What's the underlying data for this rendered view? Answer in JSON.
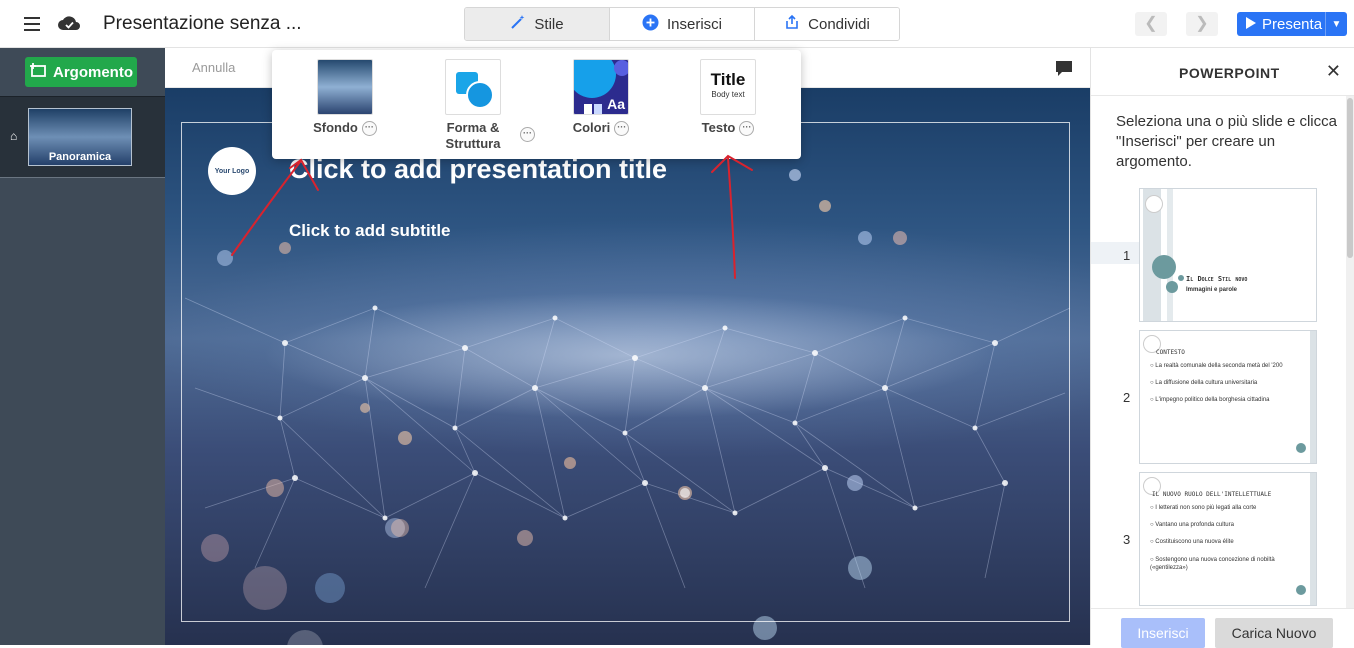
{
  "header": {
    "doc_title": "Presentazione senza ...",
    "tabs": [
      {
        "label": "Stile",
        "icon": "magic-wand-icon"
      },
      {
        "label": "Inserisci",
        "icon": "plus-circle-icon"
      },
      {
        "label": "Condividi",
        "icon": "share-icon"
      }
    ],
    "present_label": "Presenta"
  },
  "sidebar": {
    "topic_button": "Argomento",
    "thumb_label": "Panoramica"
  },
  "editor": {
    "undo_label": "Annulla",
    "logo_text": "Your Logo",
    "title_placeholder": "Click to add presentation title",
    "subtitle_placeholder": "Click to add subtitle"
  },
  "style_panel": {
    "items": [
      {
        "label": "Sfondo"
      },
      {
        "label": "Forma & Struttura"
      },
      {
        "label": "Colori",
        "badge": "Aa"
      },
      {
        "label": "Testo",
        "sample_title": "Title",
        "sample_body": "Body text"
      }
    ]
  },
  "right_panel": {
    "title": "POWERPOINT",
    "description": "Seleziona una o più slide e clicca \"Inserisci\" per creare un argomento.",
    "slides": [
      {
        "num": "1",
        "title": "Il Dolce Stil novo",
        "subtitle": "Immagini e parole",
        "bullets": []
      },
      {
        "num": "2",
        "title": "Contesto",
        "subtitle": "",
        "bullets": [
          "La realtà comunale della seconda metà del '200",
          "La diffusione della cultura universitaria",
          "L'impegno politico della borghesia cittadina"
        ]
      },
      {
        "num": "3",
        "title": "Il nuovo ruolo dell'intellettuale",
        "subtitle": "",
        "bullets": [
          "I letterati non sono più legati alla corte",
          "Vantano una profonda cultura",
          "Costituiscono una nuova élite",
          "Sostengono una nuova concezione di nobiltà («gentilezza»)"
        ]
      }
    ],
    "insert_label": "Inserisci",
    "load_label": "Carica Nuovo"
  },
  "colors": {
    "accent": "#2a74f5",
    "topic_green": "#22a84b",
    "annotation_red": "#d9232e"
  }
}
